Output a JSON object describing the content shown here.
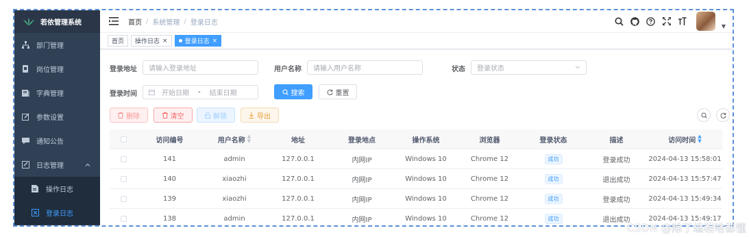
{
  "app": {
    "title": "若依管理系统"
  },
  "sidebar": {
    "items": [
      {
        "label": "部门管理",
        "icon": "tree-icon"
      },
      {
        "label": "岗位管理",
        "icon": "post-icon"
      },
      {
        "label": "字典管理",
        "icon": "dict-icon"
      },
      {
        "label": "参数设置",
        "icon": "edit-icon"
      },
      {
        "label": "通知公告",
        "icon": "message-icon"
      },
      {
        "label": "日志管理",
        "icon": "log-icon",
        "expanded": true
      }
    ],
    "sub_items": [
      {
        "label": "操作日志",
        "icon": "form-icon",
        "active": false
      },
      {
        "label": "登录日志",
        "icon": "logininfor-icon",
        "active": true
      }
    ]
  },
  "breadcrumb": [
    "首页",
    "系统管理",
    "登录日志"
  ],
  "tags": [
    {
      "label": "首页",
      "closable": false,
      "active": false
    },
    {
      "label": "操作日志",
      "closable": true,
      "active": false
    },
    {
      "label": "登录日志",
      "closable": true,
      "active": true
    }
  ],
  "form": {
    "ipaddr_label": "登录地址",
    "ipaddr_placeholder": "请输入登录地址",
    "username_label": "用户名称",
    "username_placeholder": "请输入用户名称",
    "status_label": "状态",
    "status_placeholder": "登录状态",
    "time_label": "登录时间",
    "start_placeholder": "开始日期",
    "range_sep": "-",
    "end_placeholder": "结束日期",
    "search_label": "搜索",
    "reset_label": "重置"
  },
  "toolbar": {
    "delete_label": "删除",
    "clean_label": "清空",
    "unlock_label": "解锁",
    "export_label": "导出"
  },
  "table": {
    "columns": [
      "访问编号",
      "用户名称",
      "地址",
      "登录地点",
      "操作系统",
      "浏览器",
      "登录状态",
      "描述",
      "访问时间"
    ],
    "rows": [
      {
        "id": "141",
        "user": "admin",
        "ip": "127.0.0.1",
        "loc": "内网IP",
        "os": "Windows 10",
        "browser": "Chrome 12",
        "status": "成功",
        "msg": "登录成功",
        "time": "2024-04-13 15:58:01"
      },
      {
        "id": "140",
        "user": "xiaozhi",
        "ip": "127.0.0.1",
        "loc": "内网IP",
        "os": "Windows 10",
        "browser": "Chrome 12",
        "status": "成功",
        "msg": "退出成功",
        "time": "2024-04-13 15:57:47"
      },
      {
        "id": "139",
        "user": "xiaozhi",
        "ip": "127.0.0.1",
        "loc": "内网IP",
        "os": "Windows 10",
        "browser": "Chrome 12",
        "status": "成功",
        "msg": "登录成功",
        "time": "2024-04-13 15:49:34"
      },
      {
        "id": "138",
        "user": "admin",
        "ip": "127.0.0.1",
        "loc": "内网IP",
        "os": "Windows 10",
        "browser": "Chrome 12",
        "status": "成功",
        "msg": "退出成功",
        "time": "2024-04-13 15:49:17"
      }
    ]
  },
  "watermark": "CSDN @除了编程啥都懂",
  "colors": {
    "sidebar_bg": "#304156",
    "accent": "#409eff",
    "danger": "#f56c6c",
    "warning": "#e6a23c"
  }
}
